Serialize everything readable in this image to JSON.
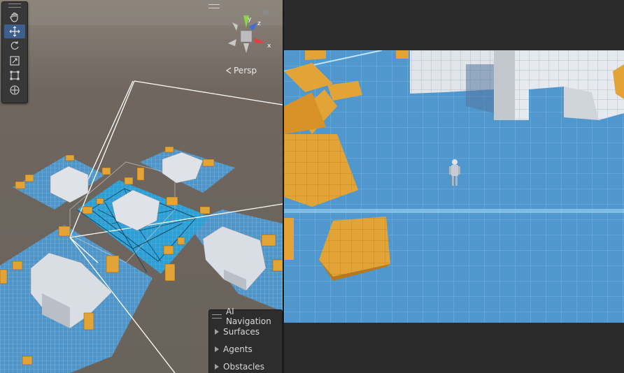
{
  "scene_view": {
    "camera_label": "Persp",
    "gizmo_axes": {
      "y": "y",
      "z": "z",
      "x": "x"
    },
    "tools": [
      {
        "name": "hand-tool",
        "icon": "hand-icon",
        "active": false
      },
      {
        "name": "move-tool",
        "icon": "move-icon",
        "active": true
      },
      {
        "name": "rotate-tool",
        "icon": "rotate-icon",
        "active": false
      },
      {
        "name": "scale-tool",
        "icon": "scale-icon",
        "active": false
      },
      {
        "name": "rect-tool",
        "icon": "rect-icon",
        "active": false
      },
      {
        "name": "transform-tool",
        "icon": "transform-icon",
        "active": false
      }
    ]
  },
  "ai_navigation": {
    "title": "AI Navigation",
    "items": [
      "Surfaces",
      "Agents",
      "Obstacles"
    ]
  },
  "colors": {
    "ground": "#5fa4d6",
    "crate": "#e3a437",
    "building": "#d9dee4",
    "accent": "#3c5f8c"
  }
}
